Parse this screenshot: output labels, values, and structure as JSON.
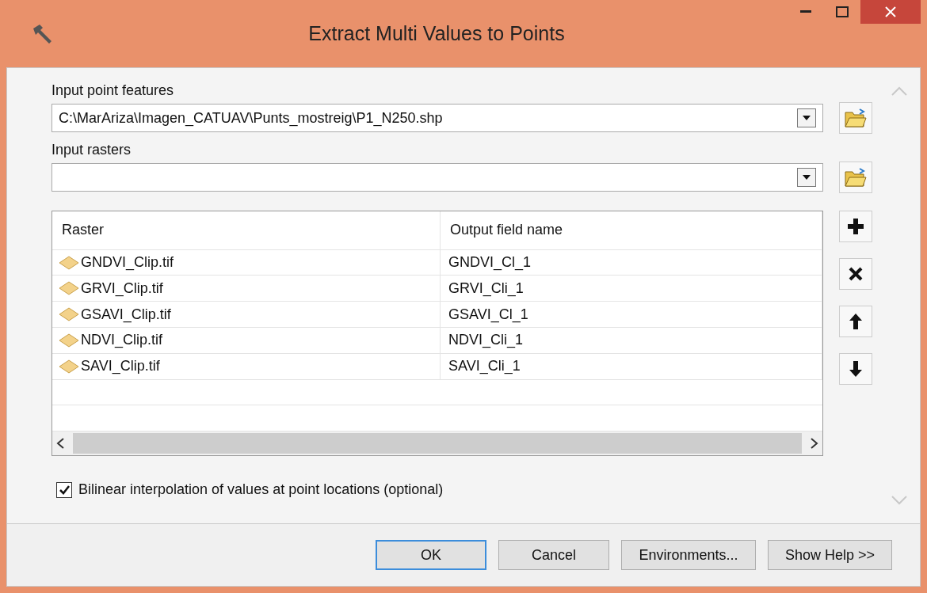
{
  "window": {
    "title": "Extract Multi Values to Points"
  },
  "fields": [
    {
      "label": "Input point features",
      "value": "C:\\MarAriza\\Imagen_CATUAV\\Punts_mostreig\\P1_N250.shp"
    },
    {
      "label": "Input rasters"
    }
  ],
  "table": {
    "columns": [
      "Raster",
      "Output field name"
    ],
    "rows": [
      {
        "raster": "GNDVI_Clip.tif",
        "output_field": "GNDVI_Cl_1"
      },
      {
        "raster": "GRVI_Clip.tif",
        "output_field": "GRVI_Cli_1"
      },
      {
        "raster": "GSAVI_Clip.tif",
        "output_field": "GSAVI_Cl_1"
      },
      {
        "raster": "NDVI_Clip.tif",
        "output_field": "NDVI_Cli_1"
      },
      {
        "raster": "SAVI_Clip.tif",
        "output_field": "SAVI_Cli_1"
      }
    ]
  },
  "side_buttons": [
    {
      "kind": "add"
    },
    {
      "kind": "remove"
    },
    {
      "kind": "up"
    },
    {
      "kind": "down"
    }
  ],
  "option": {
    "label": "Bilinear interpolation of values at point locations (optional)",
    "checked": true
  },
  "buttons": [
    {
      "label": "OK",
      "default": true
    },
    {
      "label": "Cancel",
      "default": false
    },
    {
      "label": "Environments...",
      "default": false
    },
    {
      "label": "Show Help >>",
      "default": false
    }
  ]
}
